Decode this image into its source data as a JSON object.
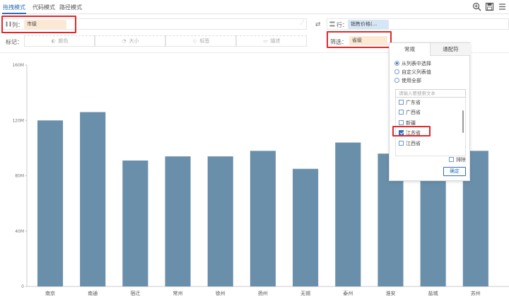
{
  "tabs": [
    {
      "label": "拖拽模式",
      "active": true
    },
    {
      "label": "代码模式",
      "active": false
    },
    {
      "label": "路径模式",
      "active": false
    }
  ],
  "toolbar_icons": [
    "zoom-icon",
    "save-icon",
    "more-icon"
  ],
  "columns_shelf": {
    "label": "列：",
    "pill": "市级"
  },
  "rows_shelf": {
    "label": "行：",
    "pill": "销售价格(..."
  },
  "filter_shelf": {
    "label": "筛选：",
    "pill": "省级"
  },
  "marks": {
    "label": "标记：",
    "items": [
      {
        "label": "颜色",
        "icon": "palette-icon"
      },
      {
        "label": "大小",
        "icon": "size-icon"
      },
      {
        "label": "标签",
        "icon": "tag-icon"
      },
      {
        "label": "描述",
        "icon": "description-icon"
      }
    ]
  },
  "filter_panel": {
    "tabs": [
      "常规",
      "通配符"
    ],
    "options": [
      {
        "label": "从列表中选择",
        "selected": true
      },
      {
        "label": "自定义列表值",
        "selected": false
      },
      {
        "label": "使用全部",
        "selected": false
      }
    ],
    "search_placeholder": "请输入要搜索文本",
    "items": [
      {
        "label": "广东省",
        "checked": false
      },
      {
        "label": "广西省",
        "checked": false
      },
      {
        "label": "新疆",
        "checked": false
      },
      {
        "label": "江苏省",
        "checked": true
      },
      {
        "label": "江西省",
        "checked": false
      }
    ],
    "exclude_label": "排除",
    "ok_label": "确定"
  },
  "chart_data": {
    "type": "bar",
    "categories": [
      "南京",
      "南通",
      "宿迁",
      "常州",
      "徐州",
      "扬州",
      "无锡",
      "泰州",
      "淮安",
      "盐城",
      "苏州"
    ],
    "values": [
      120,
      126,
      91,
      94,
      94,
      98,
      85,
      104,
      96,
      95,
      98
    ],
    "yticks": [
      "160M",
      "120M",
      "80M",
      "40M",
      "0"
    ],
    "ylim": [
      0,
      160
    ],
    "bar_color": "#6a8fab",
    "accent_color": "#2f6fb6",
    "highlight_color": "#e0282a"
  }
}
